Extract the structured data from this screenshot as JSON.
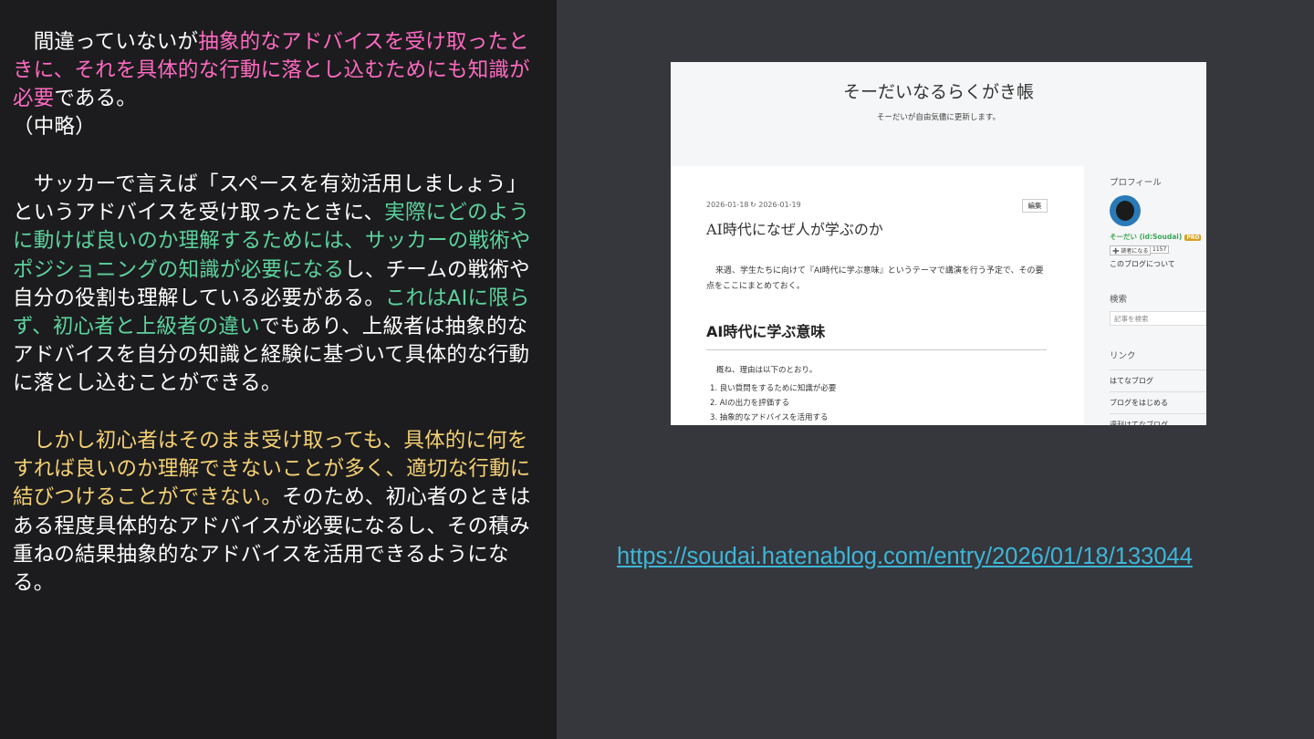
{
  "left": {
    "p1": [
      {
        "text": "　間違っていないが",
        "color": "white"
      },
      {
        "text": "抽象的なアドバイスを受け取ったときに、それを具体的な行動に落とし込むためにも知識が必要",
        "color": "pink"
      },
      {
        "text": "である。",
        "color": "white"
      }
    ],
    "omitted": "（中略）",
    "p2": [
      {
        "text": "　サッカーで言えば「スペースを有効活用しましょう」というアドバイスを受け取ったときに、",
        "color": "white"
      },
      {
        "text": "実際にどのように動けば良いのか理解するためには、サッカーの戦術やポジショニングの知識が必要になる",
        "color": "green"
      },
      {
        "text": "し、チームの戦術や自分の役割も理解している必要がある。",
        "color": "white"
      },
      {
        "text": "これはAIに限らず、初心者と上級者の違い",
        "color": "green"
      },
      {
        "text": "でもあり、上級者は抽象的なアドバイスを自分の知識と経験に基づいて具体的な行動に落とし込むことができる。",
        "color": "white"
      }
    ],
    "p3": [
      {
        "text": "　しかし初心者はそのまま受け取っても、具体的に何をすれば良いのか理解できないことが多く、適切な行動に結びつけることができない。",
        "color": "yellow"
      },
      {
        "text": "そのため、初心者のときはある程度具体的なアドバイスが必要になるし、その積み重ねの結果抽象的なアドバイスを活用できるようになる。",
        "color": "white"
      }
    ]
  },
  "blog": {
    "title": "そーだいなるらくがき帳",
    "description": "そーだいが自由気儘に更新します。",
    "article": {
      "date": "2026-01-18",
      "updated": "↻ 2026-01-19",
      "edit_label": "編集",
      "title": "AI時代になぜ人が学ぶのか",
      "intro": "来週、学生たちに向けて『AI時代に学ぶ意味』というテーマで講演を行う予定で、その要点をここにまとめておく。",
      "heading": "AI時代に学ぶ意味",
      "lead": "概ね、理由は以下のとおり。",
      "list": [
        "1. 良い質問をするために知識が必要",
        "2. AIの出力を評価する",
        "3. 抽象的なアドバイスを活用する"
      ]
    },
    "sidebar": {
      "profile_heading": "プロフィール",
      "user_name": "そーだい (id:Soudai)",
      "pro_badge": "PRO",
      "reader_button": "➕ 読者になる",
      "reader_count": "1157",
      "about_link": "このブログについて",
      "search_heading": "検索",
      "search_placeholder": "記事を検索",
      "links_heading": "リンク",
      "links": [
        "はてなブログ",
        "ブログをはじめる",
        "週刊はてなブログ"
      ]
    }
  },
  "url": "https://soudai.hatenablog.com/entry/2026/01/18/133044",
  "colors": {
    "pink": "#ff6ac1",
    "green": "#5dd39e",
    "yellow": "#f5d173",
    "link": "#3fb5d8",
    "left_bg": "#1c1c1e",
    "right_bg": "#35373c"
  }
}
